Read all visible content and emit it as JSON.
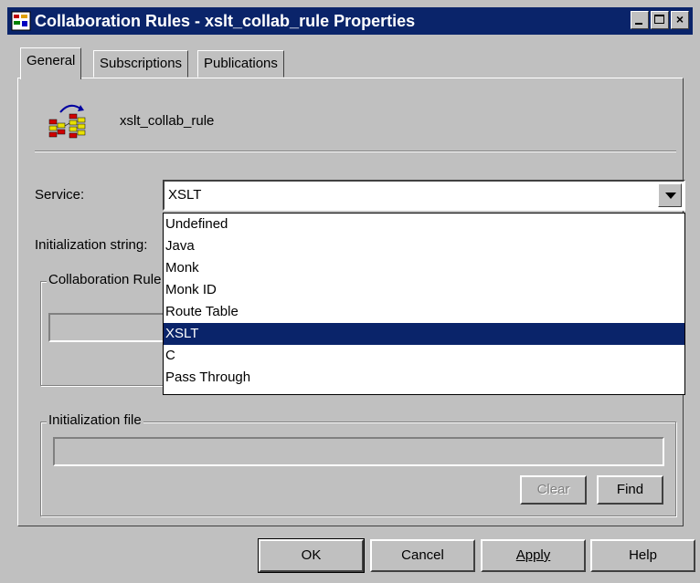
{
  "window": {
    "title": "Collaboration Rules - xslt_collab_rule Properties",
    "caption_buttons": {
      "minimize": "_",
      "maximize": "□",
      "close": "×"
    }
  },
  "tabs": [
    {
      "label": "General",
      "active": true
    },
    {
      "label": "Subscriptions",
      "active": false
    },
    {
      "label": "Publications",
      "active": false
    }
  ],
  "rule": {
    "name": "xslt_collab_rule",
    "icon": "collaboration-rule-icon"
  },
  "service": {
    "label": "Service:",
    "value": "XSLT",
    "options": [
      "Undefined",
      "Java",
      "Monk",
      "Monk ID",
      "Route Table",
      "XSLT",
      "C",
      "Pass Through"
    ],
    "selected_index": 5
  },
  "init_string": {
    "label": "Initialization string:"
  },
  "collab_rule_group": {
    "legend": "Collaboration Rule"
  },
  "init_file_group": {
    "legend": "Initialization file",
    "value": ""
  },
  "buttons": {
    "clear": "Clear",
    "find": "Find",
    "ok": "OK",
    "cancel": "Cancel",
    "apply": "Apply",
    "help": "Help"
  },
  "colors": {
    "title_bar": "#0a246a",
    "face": "#c0c0c0",
    "selection": "#0a246a"
  }
}
